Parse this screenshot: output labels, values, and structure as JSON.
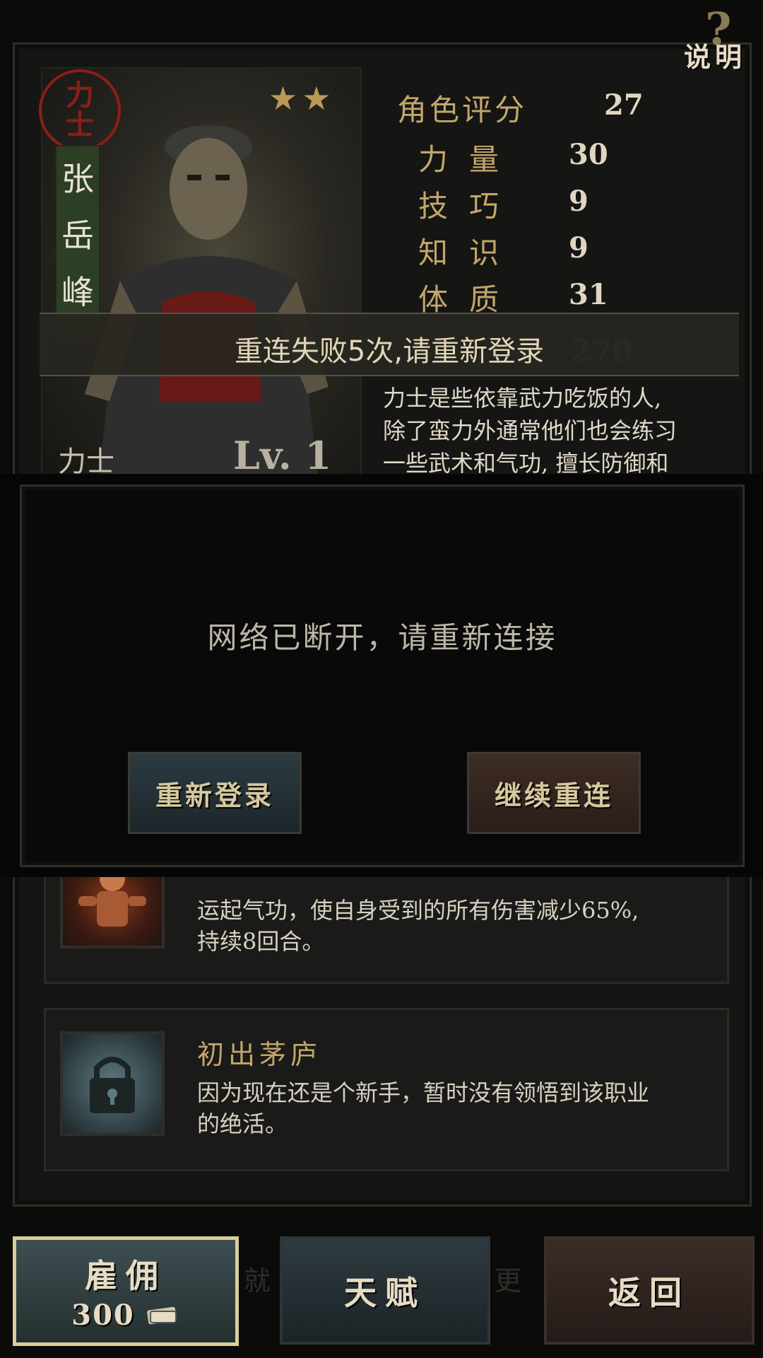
{
  "help": {
    "label": "说明",
    "glyph": "?"
  },
  "character": {
    "class_seal": [
      "力",
      "士"
    ],
    "name_chars": [
      "张",
      "岳",
      "峰"
    ],
    "stars": "★★",
    "class_label": "力士",
    "level": "Lv. 1"
  },
  "stats": [
    {
      "label": "角色评分",
      "value": "27"
    },
    {
      "label": "力量",
      "value": "30"
    },
    {
      "label": "技巧",
      "value": "9"
    },
    {
      "label": "知识",
      "value": "9"
    },
    {
      "label": "体质",
      "value": "31"
    }
  ],
  "hidden_stat_value": "270",
  "description_lines": [
    "力士是些依靠武力吃饭的人,",
    "除了蛮力外通常他们也会练习",
    "一些武术和气功, 擅长防御和"
  ],
  "toast": {
    "message": "重连失败5次,请重新登录"
  },
  "dialog": {
    "message": "网络已断开，请重新连接",
    "relogin_label": "重新登录",
    "reconnect_label": "继续重连"
  },
  "skills": [
    {
      "title": "",
      "lines": [
        "运起气功，使自身受到的所有伤害减少65%,",
        "持续8回合。"
      ]
    },
    {
      "title": "初出茅庐",
      "lines": [
        "因为现在还是个新手，暂时没有领悟到该职业",
        "的绝活。"
      ]
    }
  ],
  "bottom": {
    "hire_label": "雇佣",
    "hire_cost": "300",
    "talent_label": "天赋",
    "back_label": "返回",
    "ghost_left": "就",
    "ghost_right": "更"
  },
  "colors": {
    "accent_gold": "#c3a66a",
    "seal_red": "#8b1e18",
    "hire_border": "#d8cf9a"
  }
}
